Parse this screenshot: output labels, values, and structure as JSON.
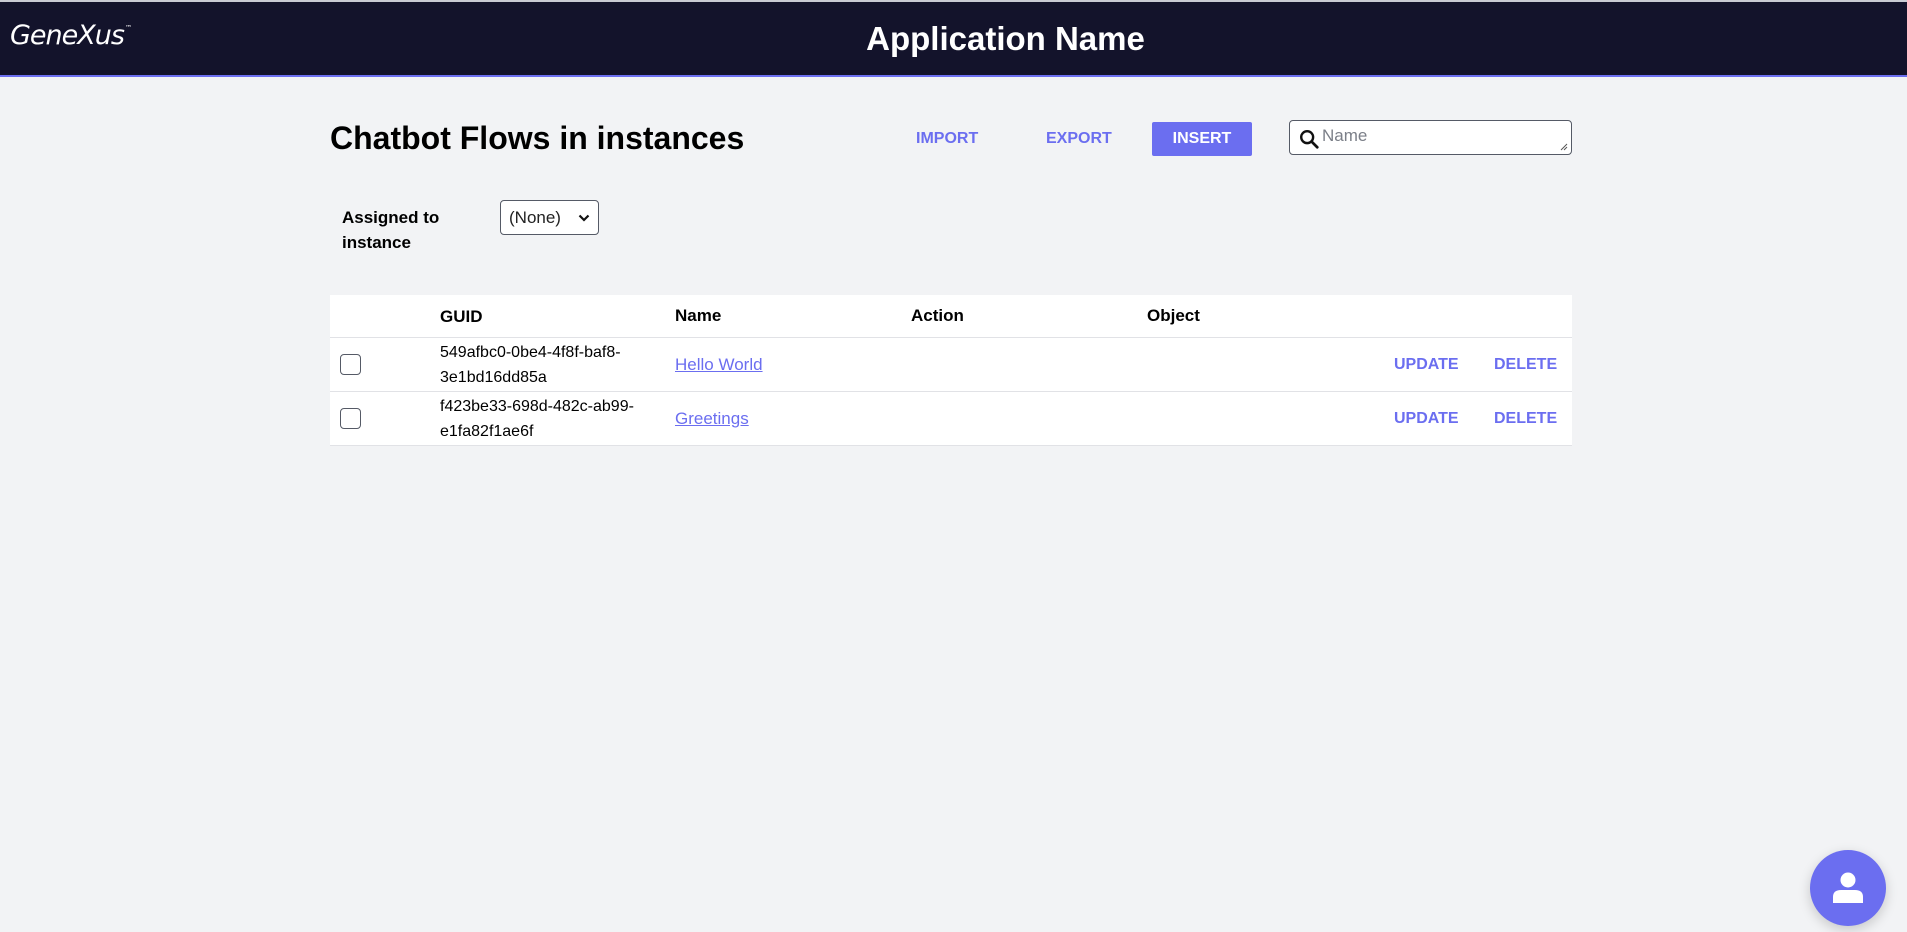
{
  "header": {
    "logo_text": "GeneXus",
    "logo_tm": "™",
    "app_title": "Application Name"
  },
  "page": {
    "title": "Chatbot Flows in instances"
  },
  "toolbar": {
    "import_label": "IMPORT",
    "export_label": "EXPORT",
    "insert_label": "INSERT",
    "search_placeholder": "Name",
    "search_value": ""
  },
  "filter": {
    "label": "Assigned to instance",
    "selected": "(None)"
  },
  "grid": {
    "columns": [
      "",
      "GUID",
      "Name",
      "Action",
      "Object"
    ],
    "rows": [
      {
        "checked": false,
        "guid_line1": "549afbc0-0be4-4f8f-baf8-",
        "guid_line2": "3e1bd16dd85a",
        "name": "Hello World",
        "action": "",
        "object": "",
        "update_label": "UPDATE",
        "delete_label": "DELETE"
      },
      {
        "checked": false,
        "guid_line1": "f423be33-698d-482c-ab99-",
        "guid_line2": "e1fa82f1ae6f",
        "name": "Greetings",
        "action": "",
        "object": "",
        "update_label": "UPDATE",
        "delete_label": "DELETE"
      }
    ]
  },
  "fab": {
    "icon": "user-icon"
  },
  "colors": {
    "header_bg": "#13132b",
    "accent": "#6b6ef0",
    "page_bg": "#f2f3f5"
  }
}
